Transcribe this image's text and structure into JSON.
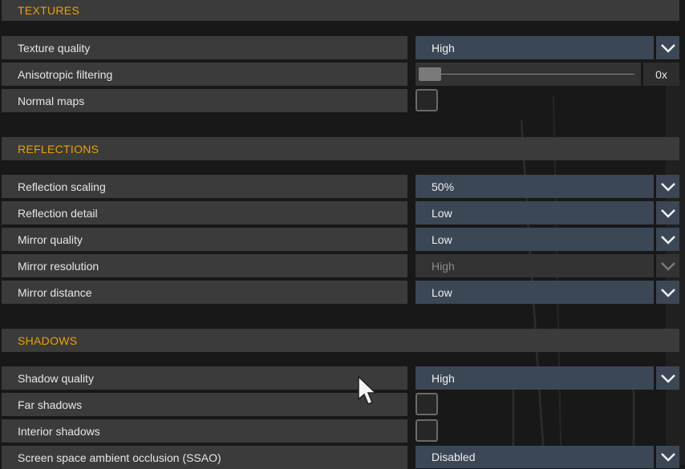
{
  "sections": {
    "textures": {
      "title": "TEXTURES",
      "texture_quality": {
        "label": "Texture quality",
        "value": "High"
      },
      "anisotropic_filtering": {
        "label": "Anisotropic filtering",
        "value": "0x",
        "slider_level": 0
      },
      "normal_maps": {
        "label": "Normal maps",
        "checked": false
      }
    },
    "reflections": {
      "title": "REFLECTIONS",
      "reflection_scaling": {
        "label": "Reflection scaling",
        "value": "50%"
      },
      "reflection_detail": {
        "label": "Reflection detail",
        "value": "Low"
      },
      "mirror_quality": {
        "label": "Mirror quality",
        "value": "Low"
      },
      "mirror_resolution": {
        "label": "Mirror resolution",
        "value": "High",
        "disabled": true
      },
      "mirror_distance": {
        "label": "Mirror distance",
        "value": "Low"
      }
    },
    "shadows": {
      "title": "SHADOWS",
      "shadow_quality": {
        "label": "Shadow quality",
        "value": "High"
      },
      "far_shadows": {
        "label": "Far shadows",
        "checked": false
      },
      "interior_shadows": {
        "label": "Interior shadows",
        "checked": false
      },
      "ssao": {
        "label": "Screen space ambient occlusion (SSAO)",
        "value": "Disabled"
      }
    }
  },
  "icons": {
    "dropdown": "chevron-down-icon",
    "cursor": "mouse-pointer-icon"
  },
  "colors": {
    "section_title": "#e8a200",
    "dropdown_bg": "#3c4756",
    "row_bg": "#3b3b3b"
  }
}
